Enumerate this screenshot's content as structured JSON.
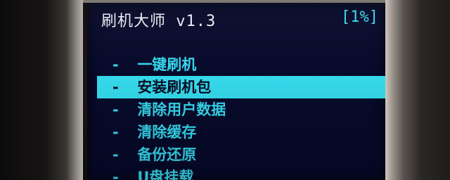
{
  "header": {
    "title": "刷机大师 v1.3",
    "progress": "[1%]"
  },
  "menu": {
    "bullet": "-",
    "selected_index": 1,
    "items": [
      {
        "label": "一键刷机"
      },
      {
        "label": "安装刷机包"
      },
      {
        "label": "清除用户数据"
      },
      {
        "label": "清除缓存"
      },
      {
        "label": "备份还原"
      },
      {
        "label": "U盘挂载"
      }
    ]
  },
  "colors": {
    "screen_background": "#070a2a",
    "accent": "#35d9ea",
    "title_text": "#e9ecf2"
  }
}
